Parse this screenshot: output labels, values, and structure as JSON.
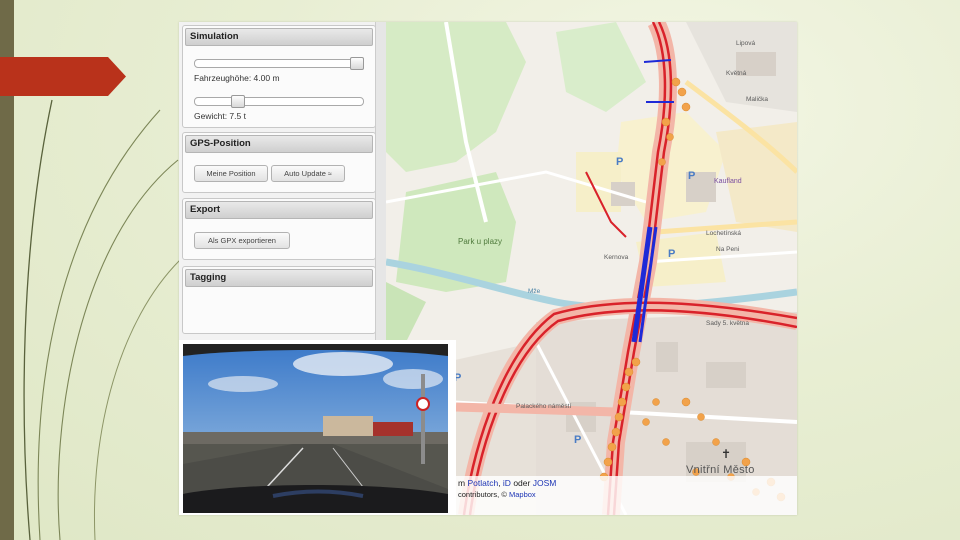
{
  "sim": {
    "title": "Simulation",
    "height_label": "Fahrzeughöhe: 4.00 m",
    "weight_label": "Gewicht: 7.5 t",
    "height_value": 1.0,
    "weight_value": 0.24
  },
  "gps": {
    "title": "GPS-Position",
    "my_position": "Meine Position",
    "auto_update": "Auto Update"
  },
  "export": {
    "title": "Export",
    "gpx": "Als GPX exportieren"
  },
  "tagging": {
    "title": "Tagging"
  },
  "map": {
    "labels": {
      "libova": "Lipová",
      "kvetna": "Květná",
      "malicka": "Malička",
      "kaufland": "Kaufland",
      "lochetinska": "Lochetínská",
      "na_pene": "Na Peni",
      "kernova": "Kernova",
      "park": "Park u plazy",
      "mze": "Mže",
      "sady5": "Sady 5. května",
      "palackeho": "Palackého náměstí",
      "vnitrni": "Vnitřní Město",
      "parking": "P"
    },
    "attribution": {
      "edit_prefix": "m",
      "potlatch": "Potlatch",
      "id": "iD",
      "oder": "oder",
      "josm": "JOSM",
      "contributors": "contributors, ©",
      "mapbox": "Mapbox"
    }
  },
  "icons": [
    "rss-icon",
    "cross-icon"
  ],
  "colors": {
    "accent": "#b9321b",
    "route": "#d9222a",
    "highlight": "#1e2ad7",
    "poi": "#f2a24a"
  }
}
